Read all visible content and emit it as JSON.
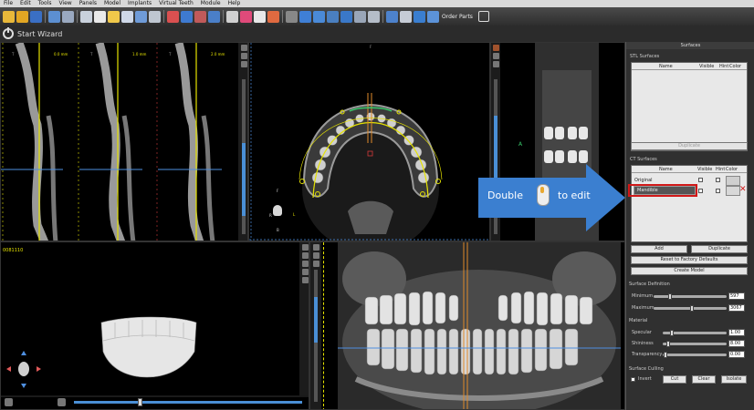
{
  "menubar": {
    "items": [
      "File",
      "Edit",
      "Tools",
      "View",
      "Panels",
      "Model",
      "Implants",
      "Virtual Teeth",
      "Module",
      "Help"
    ]
  },
  "toolbar": {
    "order_parts_label": "Order Parts"
  },
  "wizard": {
    "label": "Start Wizard"
  },
  "viewers": {
    "slice_labels": [
      "0.0 mm",
      "1.0 mm",
      "2.0 mm"
    ],
    "slice_letters": [
      "T",
      "T",
      "T"
    ],
    "axial_labels": {
      "top": "F",
      "left_letter": "F",
      "right_letter": "L",
      "bottom_letter": "R",
      "bottom_b": "B"
    },
    "volume_id": "0081110",
    "coronal_marker": "A"
  },
  "callout": {
    "text_before": "Double",
    "text_after": "to edit"
  },
  "panel": {
    "title": "Surfaces",
    "stl_section": "STL Surfaces",
    "stl_columns": [
      "Name",
      "Visible",
      "Hint",
      "Color"
    ],
    "stl_duplicate": "Duplicate",
    "ct_section": "CT Surfaces",
    "ct_columns": [
      "Name",
      "Visible",
      "Hint",
      "Color"
    ],
    "ct_rows": [
      {
        "name": "Original"
      },
      {
        "name": "Mandible"
      }
    ],
    "add": "Add",
    "duplicate": "Duplicate",
    "reset": "Reset to Factory Defaults",
    "create_model": "Create Model",
    "surface_def": "Surface Definition",
    "minimum_label": "Minimum",
    "minimum_value": "597",
    "maximum_label": "Maximum",
    "maximum_value": "3067",
    "material": "Material",
    "specular_label": "Specular",
    "specular_value": "1.00",
    "shininess_label": "Shininess",
    "shininess_value": "8.00",
    "transparency_label": "Transparency",
    "transparency_value": "0.00",
    "culling": "Surface Culling",
    "invert": "Invert",
    "cut": "Cut",
    "clear": "Clear",
    "isolate": "Isolate"
  },
  "colors": {
    "accent_blue": "#3b7fd0",
    "highlight_red": "#d01818",
    "yellow_line": "#e5e200"
  },
  "icons": [
    "open-icon",
    "save-icon",
    "undo-icon",
    "redo-icon",
    "panoramic-icon",
    "zoom-icon",
    "ruler-icon",
    "nerve-icon",
    "pan-icon",
    "order-cart-icon",
    "fullscreen-icon"
  ]
}
